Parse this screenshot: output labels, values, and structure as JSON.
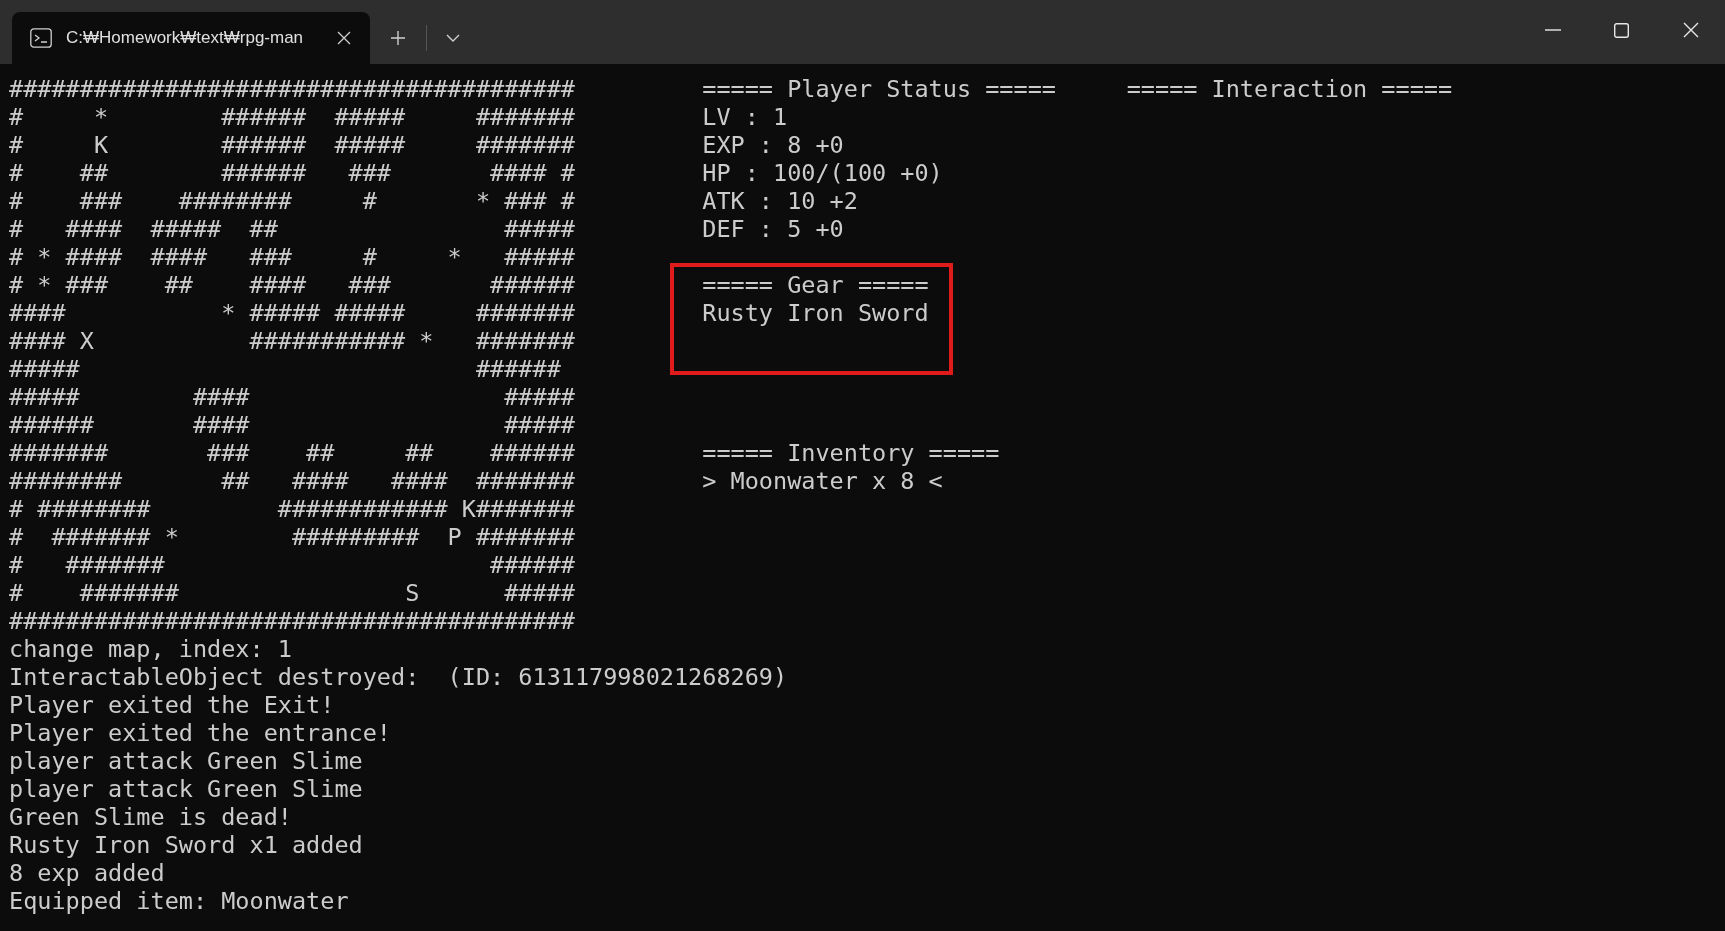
{
  "window": {
    "tabs": [
      {
        "title": "C:₩Homework₩text₩rpg-man",
        "selected": true
      }
    ]
  },
  "terminal": {
    "map_rows": [
      "########################################",
      "#     *        ######  #####     #######",
      "#     K        ######  #####     #######",
      "#    ##        ######   ###       #### #",
      "#    ###    ########     #       * ### #",
      "#   ####  #####  ##                #####",
      "# * ####  ####   ###     #     *   #####",
      "# * ###    ##    ####   ###       ######",
      "####           * ##### #####     #######",
      "#### X           ########### *   #######",
      "#####                            ######",
      "#####        ####                  #####",
      "######       ####                  #####",
      "#######       ###    ##     ##    ######",
      "########       ##   ####   ####  #######",
      "# ########         ############ K#######",
      "#  ####### *        #########  P #######",
      "#   #######                       ######",
      "#    #######                S      #####",
      "########################################"
    ],
    "status": {
      "title": "===== Player Status =====",
      "lines": [
        "LV : 1",
        "EXP : 8 +0",
        "HP : 100/(100 +0)",
        "ATK : 10 +2",
        "DEF : 5 +0"
      ]
    },
    "interaction": {
      "title": "===== Interaction ====="
    },
    "gear": {
      "title": "===== Gear =====",
      "items": [
        "Rusty Iron Sword"
      ],
      "highlighted": true
    },
    "inventory": {
      "title": "===== Inventory =====",
      "items": [
        "> Moonwater x 8 <"
      ]
    },
    "log": [
      "change map, index: 1",
      "InteractableObject destroyed:  (ID: 613117998021268269)",
      "Player exited the Exit!",
      "Player exited the entrance!",
      "player attack Green Slime",
      "player attack Green Slime",
      "Green Slime is dead!",
      "Rusty Iron Sword x1 added",
      "8 exp added",
      "Equipped item: Moonwater"
    ]
  }
}
